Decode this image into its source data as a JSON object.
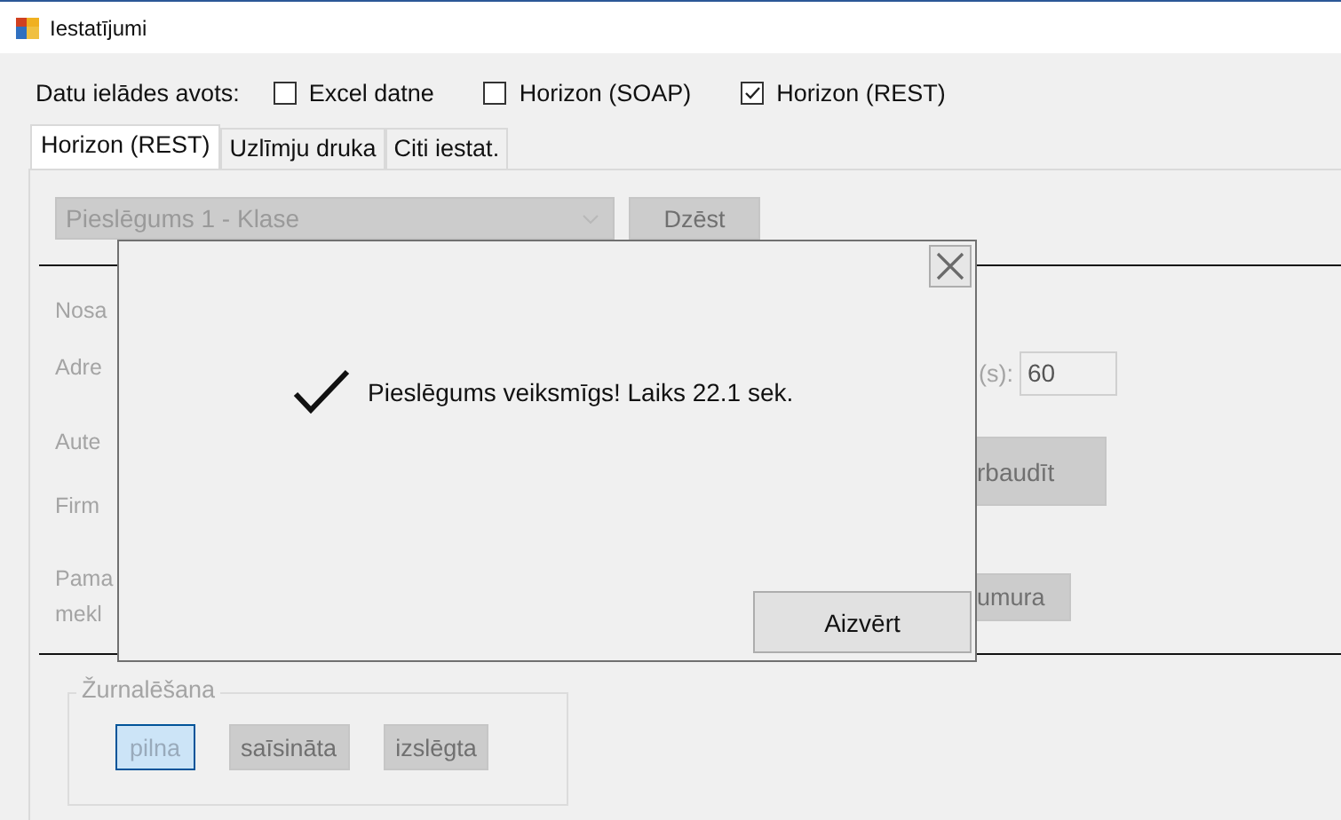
{
  "window": {
    "title": "Iestatījumi"
  },
  "source": {
    "label": "Datu ielādes avots:",
    "options": [
      {
        "label": "Excel datne",
        "checked": false
      },
      {
        "label": "Horizon (SOAP)",
        "checked": false
      },
      {
        "label": "Horizon (REST)",
        "checked": true
      }
    ]
  },
  "tabs": [
    {
      "label": "Horizon (REST)",
      "selected": true
    },
    {
      "label": "Uzlīmju druka",
      "selected": false
    },
    {
      "label": "Citi iestat.",
      "selected": false
    }
  ],
  "connection": {
    "value": "Pieslēgums 1 - Klase",
    "delete_button": "Dzēst"
  },
  "form": {
    "labels": [
      "Nosa",
      "Adre",
      "Aute",
      "Firm",
      "Pama mekl"
    ],
    "timeout_label": "(s):",
    "timeout_value": "60",
    "test_button": "rbaudīt",
    "browse_button": "umura"
  },
  "dialog": {
    "message": "Pieslēgums veiksmīgs! Laiks 22.1 sek.",
    "close_button": "Aizvērt"
  },
  "logging": {
    "title": "Žurnalēšana",
    "options": [
      {
        "label": "pilna",
        "selected": true
      },
      {
        "label": "saīsināta",
        "selected": false
      },
      {
        "label": "izslēgta",
        "selected": false
      }
    ]
  }
}
